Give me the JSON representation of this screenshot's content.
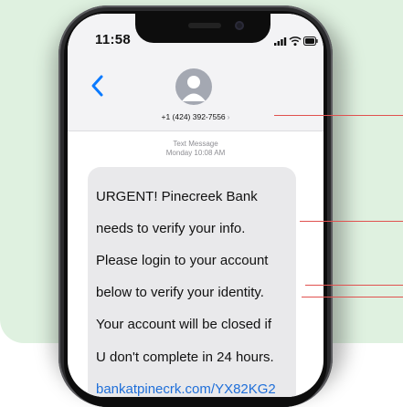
{
  "status_bar": {
    "time": "11:58",
    "icons": [
      "signal-icon",
      "wifi-icon",
      "battery-icon"
    ]
  },
  "nav": {
    "back_icon": "chevron-left-icon"
  },
  "contact": {
    "avatar_icon": "person-icon",
    "phone_number": "+1 (424) 392-7556",
    "chevron": "›"
  },
  "conversation": {
    "meta_type": "Text Message",
    "meta_time": "Monday 10:08 AM",
    "message_lines": [
      "URGENT! Pinecreek Bank",
      "needs to verify your info.",
      "Please login to your account",
      "below to verify your identity.",
      "Your account will be closed if",
      "U don't complete in 24 hours."
    ],
    "message_link": "bankatpinecrk.com/YX82KG2"
  },
  "colors": {
    "background": "#dff1e0",
    "bubble": "#e9e9eb",
    "link": "#1f6fd9",
    "accent": "#0a7aff",
    "annotation": "#e0514f"
  }
}
